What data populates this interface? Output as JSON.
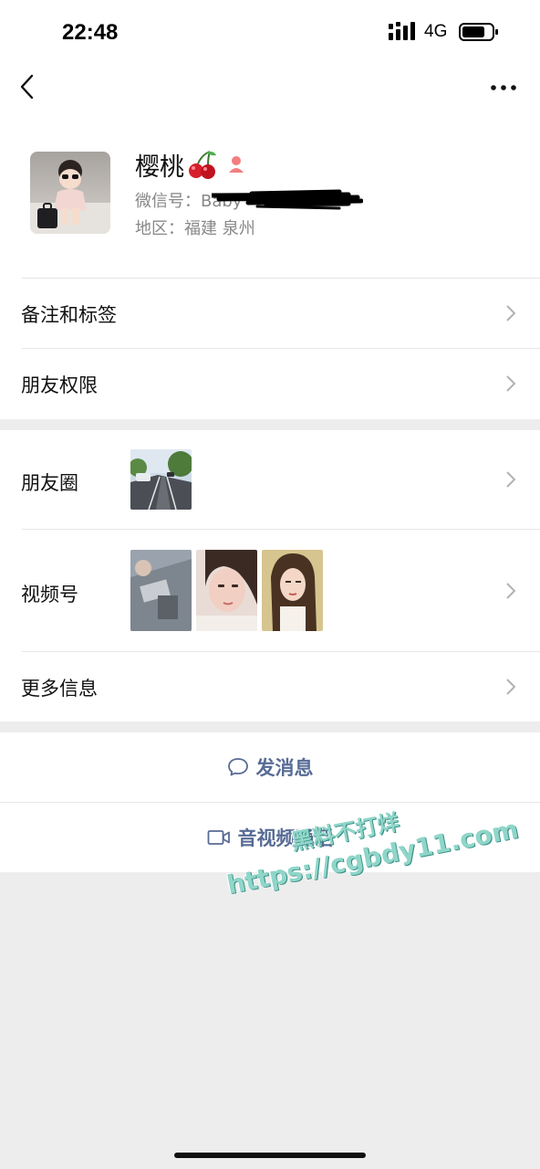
{
  "status_bar": {
    "time": "22:48",
    "network": "4G",
    "icons": [
      "signal-icon",
      "battery-icon"
    ]
  },
  "nav": {
    "back_icon": "back-chevron-icon",
    "more_icon": "more-dots-icon"
  },
  "profile": {
    "name": "樱桃",
    "name_emoji": "cherry-icon",
    "gender_icon": "female-icon",
    "wechat_id_label": "微信号：",
    "wechat_id_value": "Baby",
    "region_label": "地区：",
    "region_value": "福建 泉州"
  },
  "menu": {
    "remarks_tags": "备注和标签",
    "friend_permissions": "朋友权限",
    "moments": "朋友圈",
    "channels": "视频号",
    "more_info": "更多信息"
  },
  "actions": {
    "send_message": "发消息",
    "av_call": "音视频通话"
  },
  "watermark": {
    "line1": "黑料不打烊",
    "line2": "https://cgbdy11.com"
  },
  "colors": {
    "link_blue": "#576b95",
    "background_gray": "#ededed",
    "watermark_teal": "#8fd6c9"
  }
}
